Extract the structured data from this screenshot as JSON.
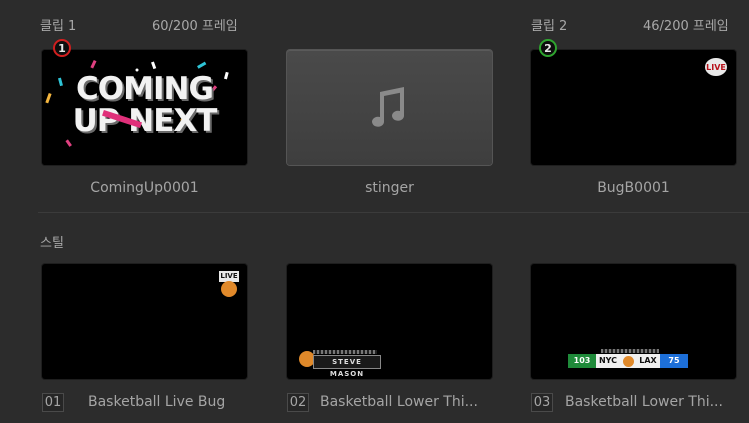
{
  "clip1": {
    "title": "클립 1",
    "frames": "60/200 프레임",
    "badge": "1"
  },
  "clip2": {
    "title": "클립 2",
    "frames": "46/200 프레임",
    "badge": "2"
  },
  "clips": [
    {
      "name": "ComingUp0001",
      "art_line1": "COMING",
      "art_line2": "UP NEXT"
    },
    {
      "name": "stinger",
      "icon": "music-note-icon"
    },
    {
      "name": "BugB0001",
      "bug": "LIVE"
    }
  ],
  "stills_label": "스틸",
  "stills": [
    {
      "num": "01",
      "name": "Basketball Live Bug",
      "bug": "LIVE"
    },
    {
      "num": "02",
      "name": "Basketball Lower Thi...",
      "lower_text": "STEVE MASON"
    },
    {
      "num": "03",
      "name": "Basketball Lower Thi...",
      "score_home": "103",
      "team_home": "NYC",
      "team_away": "LAX",
      "score_away": "75"
    }
  ],
  "colors": {
    "red_badge": "#d11f1f",
    "green_badge": "#2fa42f"
  }
}
